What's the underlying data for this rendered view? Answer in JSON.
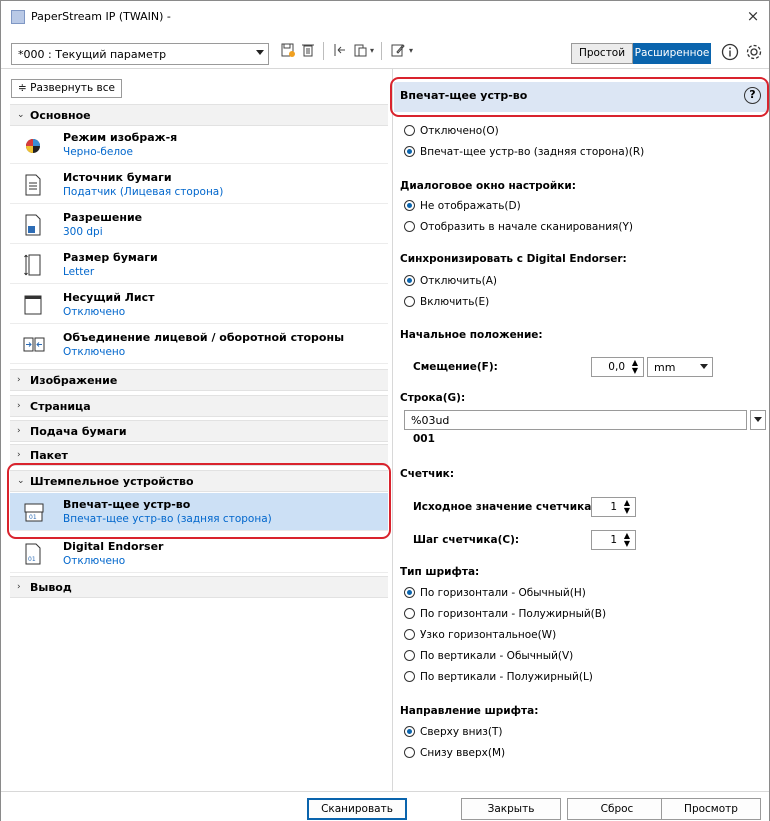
{
  "window": {
    "title": "PaperStream IP (TWAIN) -",
    "close_glyph": "×"
  },
  "toolbar": {
    "profile_value": "*000 : Текущий параметр",
    "mode_simple": "Простой",
    "mode_advanced": "Расширенное",
    "icons": [
      "save-icon",
      "delete-icon",
      "undo-icon",
      "paste-icon",
      "edit-icon",
      "info-icon",
      "gear-icon"
    ]
  },
  "left": {
    "expand_all": "≑ Развернуть все",
    "sections": {
      "basic": "Основное",
      "image": "Изображение",
      "page": "Страница",
      "feed": "Подача бумаги",
      "batch": "Пакет",
      "imprinter": "Штемпельное устройство",
      "output": "Вывод"
    },
    "chevron_open": "⌄",
    "chevron_closed": "›",
    "items": {
      "image_mode": {
        "name": "Режим изображ-я",
        "value": "Черно-белое"
      },
      "paper_source": {
        "name": "Источник бумаги",
        "value": "Податчик (Лицевая сторона)"
      },
      "resolution": {
        "name": "Разрешение",
        "value": "300 dpi"
      },
      "paper_size": {
        "name": "Размер бумаги",
        "value": "Letter"
      },
      "carrier_sheet": {
        "name": "Несущий Лист",
        "value": "Отключено"
      },
      "merge": {
        "name": "Объединение лицевой / оборотной стороны",
        "value": "Отключено"
      },
      "imprinter": {
        "name": "Впечат-щее устр-во",
        "value": "Впечат-щее устр-во (задняя сторона)"
      },
      "endorser": {
        "name": "Digital Endorser",
        "value": "Отключено"
      }
    }
  },
  "right": {
    "header": "Впечат-щее устр-во",
    "help": "?",
    "imprinter_off": "Отключено(O)",
    "imprinter_back": "Впечат-щее устр-во (задняя сторона)(R)",
    "dialog_label": "Диалоговое окно настройки:",
    "dialog_hide": "Не отображать(D)",
    "dialog_show": "Отобразить в начале сканирования(Y)",
    "sync_label": "Синхронизировать с Digital Endorser:",
    "sync_off": "Отключить(A)",
    "sync_on": "Включить(E)",
    "start_label": "Начальное положение:",
    "offset_label": "Смещение(F):",
    "offset_value": "0,0",
    "offset_unit": "mm",
    "string_label": "Строка(G):",
    "string_value": "%03ud",
    "string_preview": "001",
    "counter_label": "Счетчик:",
    "counter_initial_label": "Исходное значение счетчика(U):",
    "counter_initial_value": "1",
    "counter_step_label": "Шаг счетчика(C):",
    "counter_step_value": "1",
    "font_type_label": "Тип шрифта:",
    "font_h_normal": "По горизонтали - Обычный(H)",
    "font_h_bold": "По горизонтали - Полужирный(B)",
    "font_narrow": "Узко горизонтальное(W)",
    "font_v_normal": "По вертикали - Обычный(V)",
    "font_v_bold": "По вертикали - Полужирный(L)",
    "font_dir_label": "Направление шрифта:",
    "dir_down": "Сверху вниз(T)",
    "dir_up": "Снизу вверх(M)"
  },
  "footer": {
    "scan": "Сканировать",
    "close": "Закрыть",
    "reset": "Сброс",
    "preview": "Просмотр"
  },
  "colors": {
    "accent": "#0a64ad",
    "selection": "#cce0f5",
    "highlight_outline": "#d9232d",
    "link_text": "#0066cc"
  }
}
